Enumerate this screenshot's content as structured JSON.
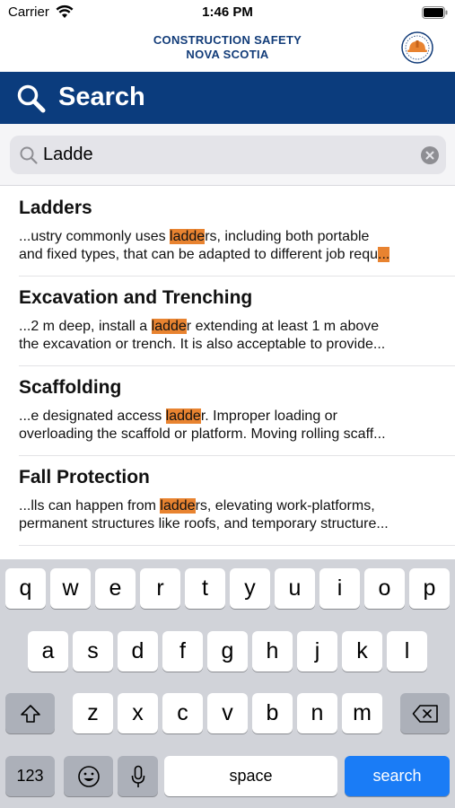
{
  "status_bar": {
    "carrier": "Carrier",
    "time": "1:46 PM"
  },
  "header": {
    "title_line1": "CONSTRUCTION SAFETY",
    "title_line2": "NOVA SCOTIA"
  },
  "banner": {
    "title": "Search"
  },
  "search": {
    "value": "Ladde"
  },
  "results": [
    {
      "title": "Ladders",
      "line1_pre": "...ustry commonly uses ",
      "line1_hl": "ladde",
      "line1_post": "rs, including both portable",
      "line2_pre": "and fixed types, that can be adapted to different job requ",
      "line2_hl": "...",
      "line2_post": ""
    },
    {
      "title": "Excavation and Trenching",
      "line1_pre": "...2 m deep, install a ",
      "line1_hl": "ladde",
      "line1_post": "r extending at least 1 m above",
      "line2_pre": "the excavation or trench.  It is also acceptable to provide...",
      "line2_hl": "",
      "line2_post": ""
    },
    {
      "title": "Scaffolding",
      "line1_pre": "...e designated access ",
      "line1_hl": "ladde",
      "line1_post": "r.  Improper loading or",
      "line2_pre": "overloading the scaffold or platform.  Moving rolling scaff...",
      "line2_hl": "",
      "line2_post": ""
    },
    {
      "title": "Fall Protection",
      "line1_pre": "...lls can happen from ",
      "line1_hl": "ladde",
      "line1_post": "rs, elevating work-platforms,",
      "line2_pre": "permanent structures like roofs, and temporary structure...",
      "line2_hl": "",
      "line2_post": ""
    }
  ],
  "keyboard": {
    "row1": [
      "q",
      "w",
      "e",
      "r",
      "t",
      "y",
      "u",
      "i",
      "o",
      "p"
    ],
    "row2": [
      "a",
      "s",
      "d",
      "f",
      "g",
      "h",
      "j",
      "k",
      "l"
    ],
    "row3": [
      "z",
      "x",
      "c",
      "v",
      "b",
      "n",
      "m"
    ],
    "numbers_label": "123",
    "space_label": "space",
    "search_label": "search"
  },
  "colors": {
    "brand_navy": "#0b3c7d",
    "highlight": "#e88330",
    "search_key": "#1a7cf6"
  }
}
